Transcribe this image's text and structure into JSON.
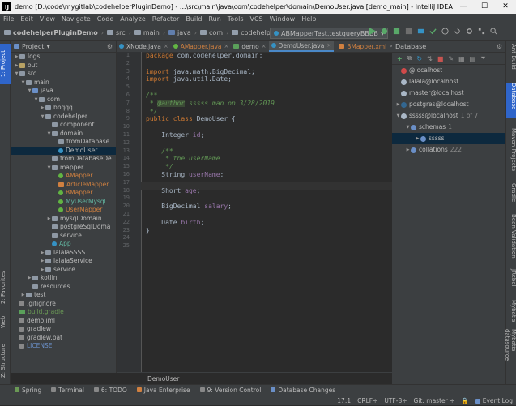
{
  "window": {
    "title": "demo [D:\\code\\mygitlab\\codehelperPluginDemo] - ...\\src\\main\\java\\com\\codehelper\\domain\\DemoUser.java [demo_main] - IntelliJ IDEA",
    "minimize": "—",
    "maximize": "☐",
    "close": "✕"
  },
  "menu": [
    "File",
    "Edit",
    "View",
    "Navigate",
    "Code",
    "Analyze",
    "Refactor",
    "Build",
    "Run",
    "Tools",
    "VCS",
    "Window",
    "Help"
  ],
  "breadcrumbs": [
    "codehelperPluginDemo",
    "src",
    "main",
    "java",
    "com",
    "codehelper",
    "domain",
    "DemoUser"
  ],
  "run_config": "ABMapperTest.testqueryBBBB",
  "left_tabs": [
    "1: Project",
    "2: Favorites",
    "Web",
    "Z: Structure"
  ],
  "right_tabs": [
    "Ant Build",
    "Database",
    "Maven Projects",
    "Gradle",
    "Bean Validation",
    "JRebel",
    "Mybatis",
    "Mybatis datasource"
  ],
  "project": {
    "header": "Project",
    "tree": [
      {
        "label": "logs",
        "indent": 1,
        "icon": "f",
        "arrow": "▶"
      },
      {
        "label": "out",
        "indent": 1,
        "icon": "fy",
        "arrow": "▶"
      },
      {
        "label": "src",
        "indent": 1,
        "icon": "f",
        "arrow": "▼"
      },
      {
        "label": "main",
        "indent": 2,
        "icon": "f",
        "arrow": "▼"
      },
      {
        "label": "java",
        "indent": 3,
        "icon": "fb",
        "arrow": "▼"
      },
      {
        "label": "com",
        "indent": 4,
        "icon": "f",
        "arrow": "▼"
      },
      {
        "label": "bbqqq",
        "indent": 5,
        "icon": "f",
        "arrow": "▶"
      },
      {
        "label": "codehelper",
        "indent": 5,
        "icon": "f",
        "arrow": "▼"
      },
      {
        "label": "component",
        "indent": 6,
        "icon": "f",
        "arrow": ""
      },
      {
        "label": "domain",
        "indent": 6,
        "icon": "f",
        "arrow": "▼"
      },
      {
        "label": "fromDatabase",
        "indent": 7,
        "icon": "f",
        "arrow": ""
      },
      {
        "label": "DemoUser",
        "indent": 7,
        "icon": "c",
        "arrow": "",
        "selected": true
      },
      {
        "label": "fromDatabaseDe",
        "indent": 6,
        "icon": "f",
        "arrow": ""
      },
      {
        "label": "mapper",
        "indent": 6,
        "icon": "f",
        "arrow": "▼"
      },
      {
        "label": "AMapper",
        "indent": 7,
        "icon": "i",
        "arrow": "",
        "color": "orange"
      },
      {
        "label": "ArticleMapper",
        "indent": 7,
        "icon": "x",
        "arrow": "",
        "color": "orange"
      },
      {
        "label": "BMapper",
        "indent": 7,
        "icon": "i",
        "arrow": "",
        "color": "orange"
      },
      {
        "label": "MyUserMysql",
        "indent": 7,
        "icon": "i",
        "arrow": "",
        "color": "teal"
      },
      {
        "label": "UserMapper",
        "indent": 7,
        "icon": "i",
        "arrow": "",
        "color": "orange"
      },
      {
        "label": "mysqlDomain",
        "indent": 6,
        "icon": "f",
        "arrow": "▶"
      },
      {
        "label": "postgreSqlDoma",
        "indent": 6,
        "icon": "f",
        "arrow": ""
      },
      {
        "label": "service",
        "indent": 6,
        "icon": "f",
        "arrow": ""
      },
      {
        "label": "App",
        "indent": 6,
        "icon": "c",
        "arrow": "",
        "color": "teal"
      },
      {
        "label": "lalalaSSSS",
        "indent": 5,
        "icon": "f",
        "arrow": "▶"
      },
      {
        "label": "lalalaService",
        "indent": 5,
        "icon": "f",
        "arrow": "▶"
      },
      {
        "label": "service",
        "indent": 5,
        "icon": "f",
        "arrow": "▶"
      },
      {
        "label": "kotlin",
        "indent": 3,
        "icon": "f",
        "arrow": "▶"
      },
      {
        "label": "resources",
        "indent": 3,
        "icon": "f",
        "arrow": ""
      },
      {
        "label": "test",
        "indent": 2,
        "icon": "f",
        "arrow": "▶"
      },
      {
        "label": ".gitignore",
        "indent": 1,
        "icon": "fl",
        "arrow": ""
      },
      {
        "label": "build.gradle",
        "indent": 1,
        "icon": "g",
        "arrow": "",
        "color": "green"
      },
      {
        "label": "demo.iml",
        "indent": 1,
        "icon": "fl",
        "arrow": ""
      },
      {
        "label": "gradlew",
        "indent": 1,
        "icon": "fl",
        "arrow": ""
      },
      {
        "label": "gradlew.bat",
        "indent": 1,
        "icon": "fl",
        "arrow": ""
      },
      {
        "label": "LICENSE",
        "indent": 1,
        "icon": "fl",
        "arrow": "",
        "color": "lic"
      }
    ]
  },
  "editor": {
    "tabs": [
      {
        "label": "XNode.java",
        "icon": "c"
      },
      {
        "label": "AMapper.java",
        "icon": "i"
      },
      {
        "label": "demo",
        "icon": "g"
      },
      {
        "label": "DemoUser.java",
        "icon": "c",
        "active": true
      },
      {
        "label": "BMapper.xml",
        "icon": "x"
      }
    ],
    "line_numbers": [
      "1",
      "2",
      "3",
      "4",
      "5",
      "6",
      "7",
      "8",
      "9",
      "10",
      "11",
      "12",
      "13",
      "14",
      "15",
      "16",
      "17",
      "18",
      "19",
      "20",
      "21",
      "22",
      "23",
      "24",
      "25"
    ],
    "code": {
      "l1_kw": "package",
      "l1_rest": " com.codehelper.domain;",
      "l3_kw": "import",
      "l3_rest": " java.math.BigDecimal;",
      "l4_kw": "import",
      "l4_rest": " java.util.Date;",
      "l6": "/**",
      "l7_star": " * ",
      "l7_tag": "@author",
      "l7_rest": " sssss man on 3/28/2019",
      "l8": " */",
      "l9_kw": "public class",
      "l9_rest": " DemoUser {",
      "l11_type": "    Integer ",
      "l11_field": "id",
      "l11_end": ";",
      "l13": "    /**",
      "l14": "     * the userName",
      "l15": "     */",
      "l16_type": "    String ",
      "l16_field": "userName",
      "l16_end": ";",
      "l18_type": "    Short ",
      "l18_field": "age",
      "l18_end": ";",
      "l20_type": "    BigDecimal ",
      "l20_field": "salary",
      "l20_end": ";",
      "l22_type": "    Date ",
      "l22_field": "birth",
      "l22_end": ";",
      "l23": "}"
    },
    "footer_crumb": "DemoUser"
  },
  "database": {
    "header": "Database",
    "rows": [
      {
        "label": "@localhost",
        "indent": 0,
        "arrow": "",
        "icon_color": "#d04a4a"
      },
      {
        "label": "lalala@localhost",
        "indent": 0,
        "arrow": "",
        "icon_color": "#a9b7c6"
      },
      {
        "label": "master@localhost",
        "indent": 0,
        "arrow": "",
        "icon_color": "#a9b7c6"
      },
      {
        "label": "postgres@localhost",
        "indent": 0,
        "arrow": "▶",
        "icon_color": "#336791"
      },
      {
        "label": "sssss@localhost",
        "indent": 0,
        "arrow": "▼",
        "icon_color": "#a9b7c6",
        "dim": "1 of 7"
      },
      {
        "label": "schemas",
        "indent": 1,
        "arrow": "▼",
        "icon_color": "#6a8fc7",
        "dim": "1"
      },
      {
        "label": "sssss",
        "indent": 2,
        "arrow": "▶",
        "icon_color": "#6a8fc7",
        "selected": true
      },
      {
        "label": "collations",
        "indent": 1,
        "arrow": "▶",
        "icon_color": "#6a8fc7",
        "dim": "222"
      }
    ]
  },
  "tool_windows": [
    "Spring",
    "Terminal",
    "6: TODO",
    "Java Enterprise",
    "9: Version Control",
    "Database Changes"
  ],
  "status": {
    "position": "17:1",
    "line_sep": "CRLF÷",
    "encoding": "UTF-8÷",
    "git": "Git: master ÷",
    "event_log": "Event Log"
  },
  "colors": {
    "accent": "#2f65ca",
    "selection": "#0d293e",
    "editor_bg": "#2b2b2b",
    "panel_bg": "#3c3f41"
  }
}
